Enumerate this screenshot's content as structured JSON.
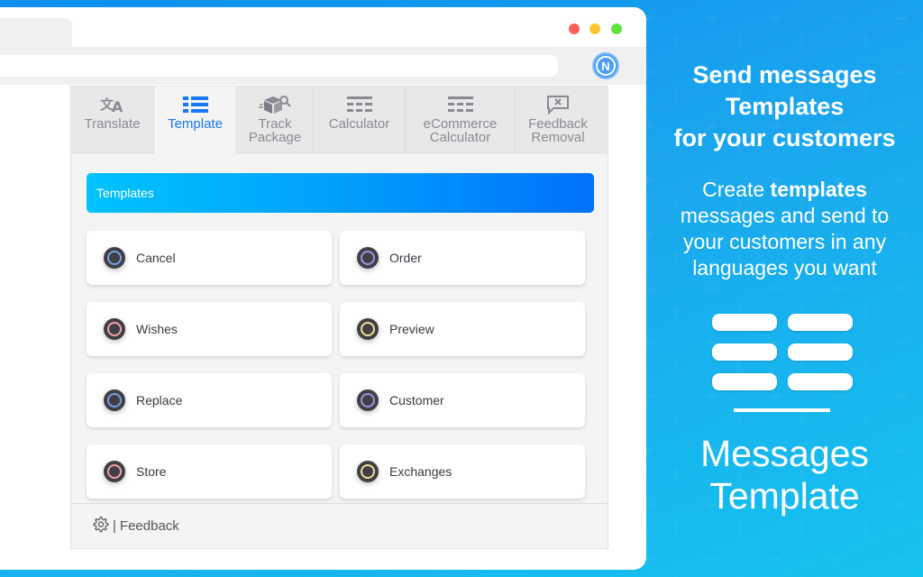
{
  "browser": {
    "traffic_lights": {
      "close": "#fe6057",
      "minimize": "#fec42e",
      "maximize": "#5ee43f"
    },
    "extension_icon": {
      "name": "n-logo-icon",
      "letter": "N",
      "color": "#4b9ff7"
    }
  },
  "popup": {
    "tabs": [
      {
        "label": "Translate",
        "icon": "translate-icon",
        "active": false
      },
      {
        "label": "Template",
        "icon": "list-icon",
        "active": true
      },
      {
        "label": "Track Package",
        "icon": "package-search-icon",
        "active": false
      },
      {
        "label": "Calculator",
        "icon": "calculator-icon",
        "active": false
      },
      {
        "label": "eCommerce Calculator",
        "icon": "calculator-icon",
        "active": false
      },
      {
        "label": "Feedback Removal",
        "icon": "message-x-icon",
        "active": false
      }
    ],
    "section_header": "Templates",
    "templates": [
      {
        "label": "Cancel",
        "ring_color": "#7a9ee8"
      },
      {
        "label": "Order",
        "ring_color": "#a88de0"
      },
      {
        "label": "Wishes",
        "ring_color": "#f0a2a2"
      },
      {
        "label": "Preview",
        "ring_color": "#eee48e"
      },
      {
        "label": "Replace",
        "ring_color": "#7a9ee8"
      },
      {
        "label": "Customer",
        "ring_color": "#a88de0"
      },
      {
        "label": "Store",
        "ring_color": "#f0a2a2"
      },
      {
        "label": "Exchanges",
        "ring_color": "#eee48e"
      }
    ],
    "footer": {
      "separator": "|",
      "link": "Feedback",
      "icon": "gear-icon"
    },
    "accent": "#1678f2"
  },
  "promo": {
    "title_lines": [
      "Send messages",
      "Templates",
      "for your customers"
    ],
    "desc_prefix": "Create ",
    "desc_bold": "templates",
    "desc_rest_lines": [
      "messages and send to",
      "your customers in any",
      "languages you want"
    ],
    "name_lines": [
      "Messages",
      "Template"
    ]
  }
}
